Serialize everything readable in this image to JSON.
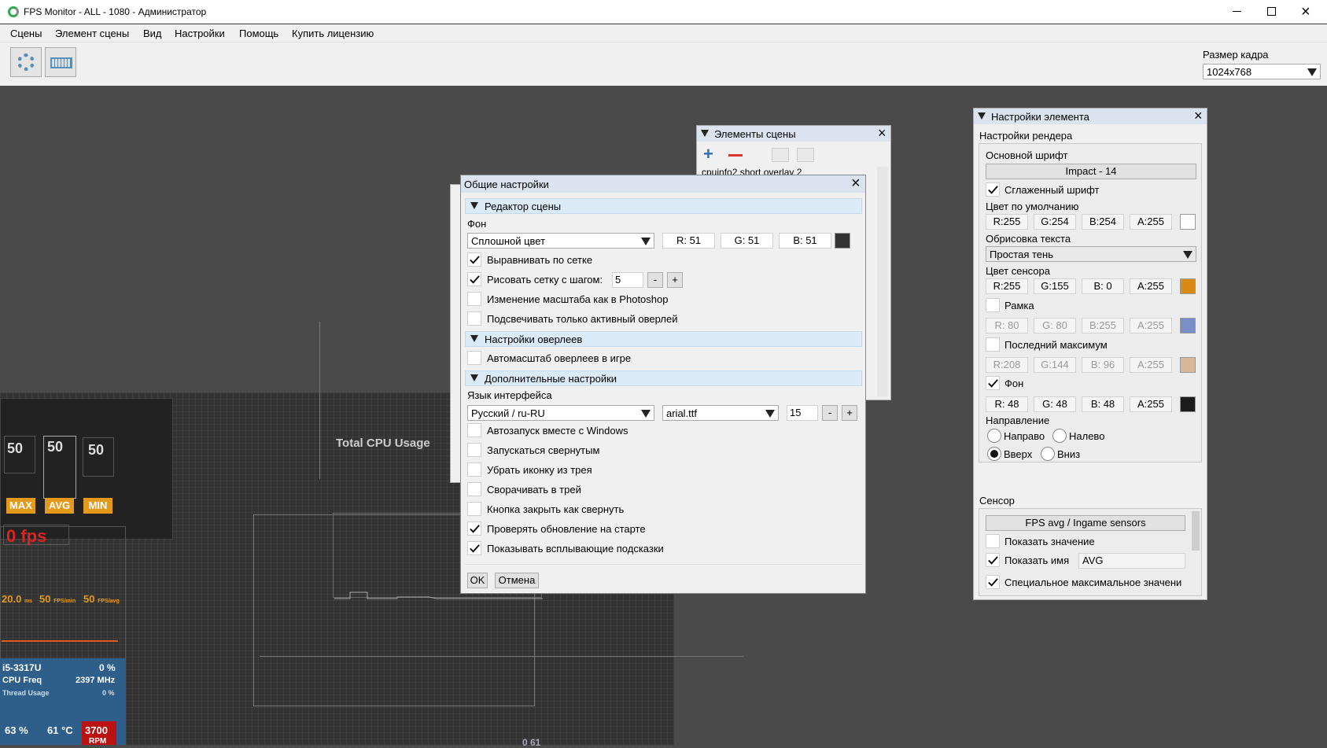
{
  "titlebar": {
    "title": "FPS Monitor - ALL - 1080 - Администратор"
  },
  "menu": [
    "Сцены",
    "Элемент сцены",
    "Вид",
    "Настройки",
    "Помощь",
    "Купить лицензию"
  ],
  "frame": {
    "label": "Размер кадра",
    "value": "1024x768"
  },
  "overlay": {
    "fps_vals": [
      "50",
      "50",
      "50"
    ],
    "fps_tags": [
      "MAX",
      "AVG",
      "MIN"
    ],
    "fps_big": "0 fps",
    "frametime": [
      "20.0",
      "50",
      "50"
    ],
    "frametime_units": [
      "ms",
      "FPS/min",
      "FPS/avg"
    ],
    "cpu_model": "i5-3317U",
    "cpu_pct": "0 %",
    "cpu_freq_label": "CPU Freq",
    "cpu_freq": "2397 MHz",
    "thread_label": "Thread Usage",
    "thread_pct": "0 %",
    "bottom": [
      "63 %",
      "61 °C",
      "3700"
    ],
    "rpm": "RPM",
    "chart_title": "Total CPU Usage",
    "partial": "0     61"
  },
  "scene_panel": {
    "title": "Элементы сцены",
    "item": "cpuinfo2 short overlay 2"
  },
  "settings": {
    "title": "Общие настройки",
    "sec1": "Редактор сцены",
    "bg_label": "Фон",
    "bg_type": "Сплошной цвет",
    "r": "R: 51",
    "g": "G: 51",
    "b": "B: 51",
    "align": "Выравнивать по сетке",
    "grid": "Рисовать сетку с шагом:",
    "grid_step": "5",
    "minus": "-",
    "plus": "+",
    "photoshop": "Изменение масштаба как в Photoshop",
    "highlight": "Подсвечивать только активный оверлей",
    "sec2": "Настройки оверлеев",
    "autoscale": "Автомасштаб оверлеев в игре",
    "sec3": "Дополнительные настройки",
    "lang_label": "Язык интерфейса",
    "lang": "Русский / ru-RU",
    "font": "arial.ttf",
    "font_size": "15",
    "opts": [
      "Автозапуск вместе с Windows",
      "Запускаться свернутым",
      "Убрать иконку из трея",
      "Сворачивать в трей",
      "Кнопка закрыть как свернуть",
      "Проверять обновление на старте",
      "Показывать всплывающие подсказки"
    ],
    "opts_checked": [
      false,
      false,
      false,
      false,
      false,
      true,
      true
    ],
    "ok": "OK",
    "cancel": "Отмена"
  },
  "element": {
    "title": "Настройки элемента",
    "render": "Настройки рендера",
    "main_font": "Основной шрифт",
    "font_btn": "Impact - 14",
    "smooth": "Сглаженный шрифт",
    "default_color": "Цвет по умолчанию",
    "dc": [
      "R:255",
      "G:254",
      "B:254",
      "A:255"
    ],
    "outline": "Обрисовка текста",
    "outline_val": "Простая тень",
    "sensor_color": "Цвет сенсора",
    "sc": [
      "R:255",
      "G:155",
      "B: 0",
      "A:255"
    ],
    "frame": "Рамка",
    "fc": [
      "R: 80",
      "G: 80",
      "B:255",
      "A:255"
    ],
    "lastmax": "Последний максимум",
    "lc": [
      "R:208",
      "G:144",
      "B: 96",
      "A:255"
    ],
    "bg": "Фон",
    "bc": [
      "R: 48",
      "G: 48",
      "B: 48",
      "A:255"
    ],
    "direction": "Направление",
    "dirs": [
      "Направо",
      "Налево",
      "Вверх",
      "Вниз"
    ],
    "sensor": "Сенсор",
    "sensor_btn": "FPS avg / Ingame sensors",
    "show_value": "Показать значение",
    "show_name": "Показать имя",
    "name_val": "AVG",
    "special": "Специальное максимальное значени",
    "colors": {
      "default": "#fffefe",
      "sensor": "#ff9b00",
      "frame": "#5050ff",
      "lastmax": "#d09060",
      "bg": "#303030"
    }
  }
}
